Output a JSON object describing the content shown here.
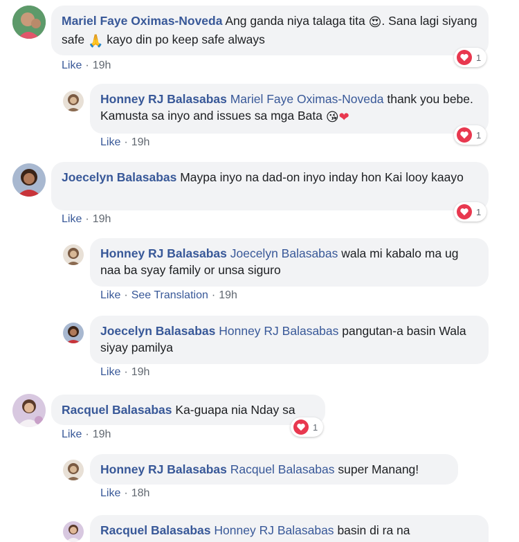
{
  "comments": [
    {
      "author": "Mariel Faye Oximas-Noveda",
      "text_1": "Ang ganda niya talaga tita",
      "emoji_1": "😍",
      "text_2": ". Sana lagi siyang safe",
      "emoji_2": "🙏",
      "text_3": "kayo din po keep safe always",
      "like": "Like",
      "time": "19h",
      "reaction_count": "1"
    },
    {
      "author": "Honney RJ Balasabas",
      "mention": "Mariel Faye Oximas-Noveda",
      "text_1": "thank you bebe. Kamusta sa inyo and issues sa mga Bata",
      "emoji_1": "😘",
      "emoji_2": "❤",
      "like": "Like",
      "time": "19h",
      "reaction_count": "1"
    },
    {
      "author": "Joecelyn Balasabas",
      "text_1": "Maypa inyo na dad-on inyo inday hon Kai looy kaayo",
      "like": "Like",
      "time": "19h",
      "reaction_count": "1"
    },
    {
      "author": "Honney RJ Balasabas",
      "mention": "Joecelyn Balasabas",
      "text_1": "wala mi kabalo ma ug naa ba syay family or unsa siguro",
      "like": "Like",
      "see_translation": "See Translation",
      "time": "19h"
    },
    {
      "author": "Joecelyn Balasabas",
      "mention": "Honney RJ Balasabas",
      "text_1": "pangutan-a basin Wala siyay pamilya",
      "like": "Like",
      "time": "19h"
    },
    {
      "author": "Racquel Balasabas",
      "text_1": "Ka-guapa nia Nday sa",
      "like": "Like",
      "time": "19h",
      "reaction_count": "1"
    },
    {
      "author": "Honney RJ Balasabas",
      "mention": "Racquel Balasabas",
      "text_1": "super Manang!",
      "like": "Like",
      "time": "18h"
    },
    {
      "author": "Racquel Balasabas",
      "mention": "Honney RJ Balasabas",
      "text_1": "basin di ra na"
    }
  ],
  "icons": {
    "reaction": "heart-icon"
  },
  "colors": {
    "author": "#385898",
    "bubble": "#f2f3f5",
    "heart": "#e8384f",
    "meta": "#606770"
  }
}
